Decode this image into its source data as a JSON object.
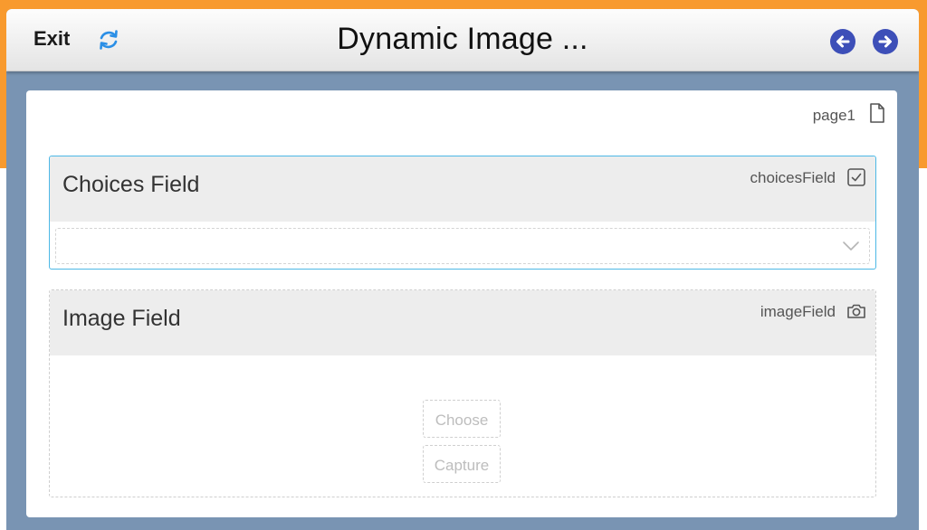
{
  "header": {
    "exit_label": "Exit",
    "title": "Dynamic Image ...",
    "refresh_icon": "refresh-icon",
    "back_icon": "arrow-left-icon",
    "forward_icon": "arrow-right-icon"
  },
  "page": {
    "name": "page1"
  },
  "fields": {
    "choices": {
      "title": "Choices Field",
      "name": "choicesField",
      "selected_value": ""
    },
    "image": {
      "title": "Image Field",
      "name": "imageField",
      "choose_label": "Choose",
      "capture_label": "Capture"
    }
  },
  "colors": {
    "accent_orange": "#f89a2e",
    "frame_blue": "#7994b3",
    "nav_button": "#3d4fb8",
    "refresh_icon": "#2b8fe6",
    "focus_border": "#4cb8e6"
  }
}
